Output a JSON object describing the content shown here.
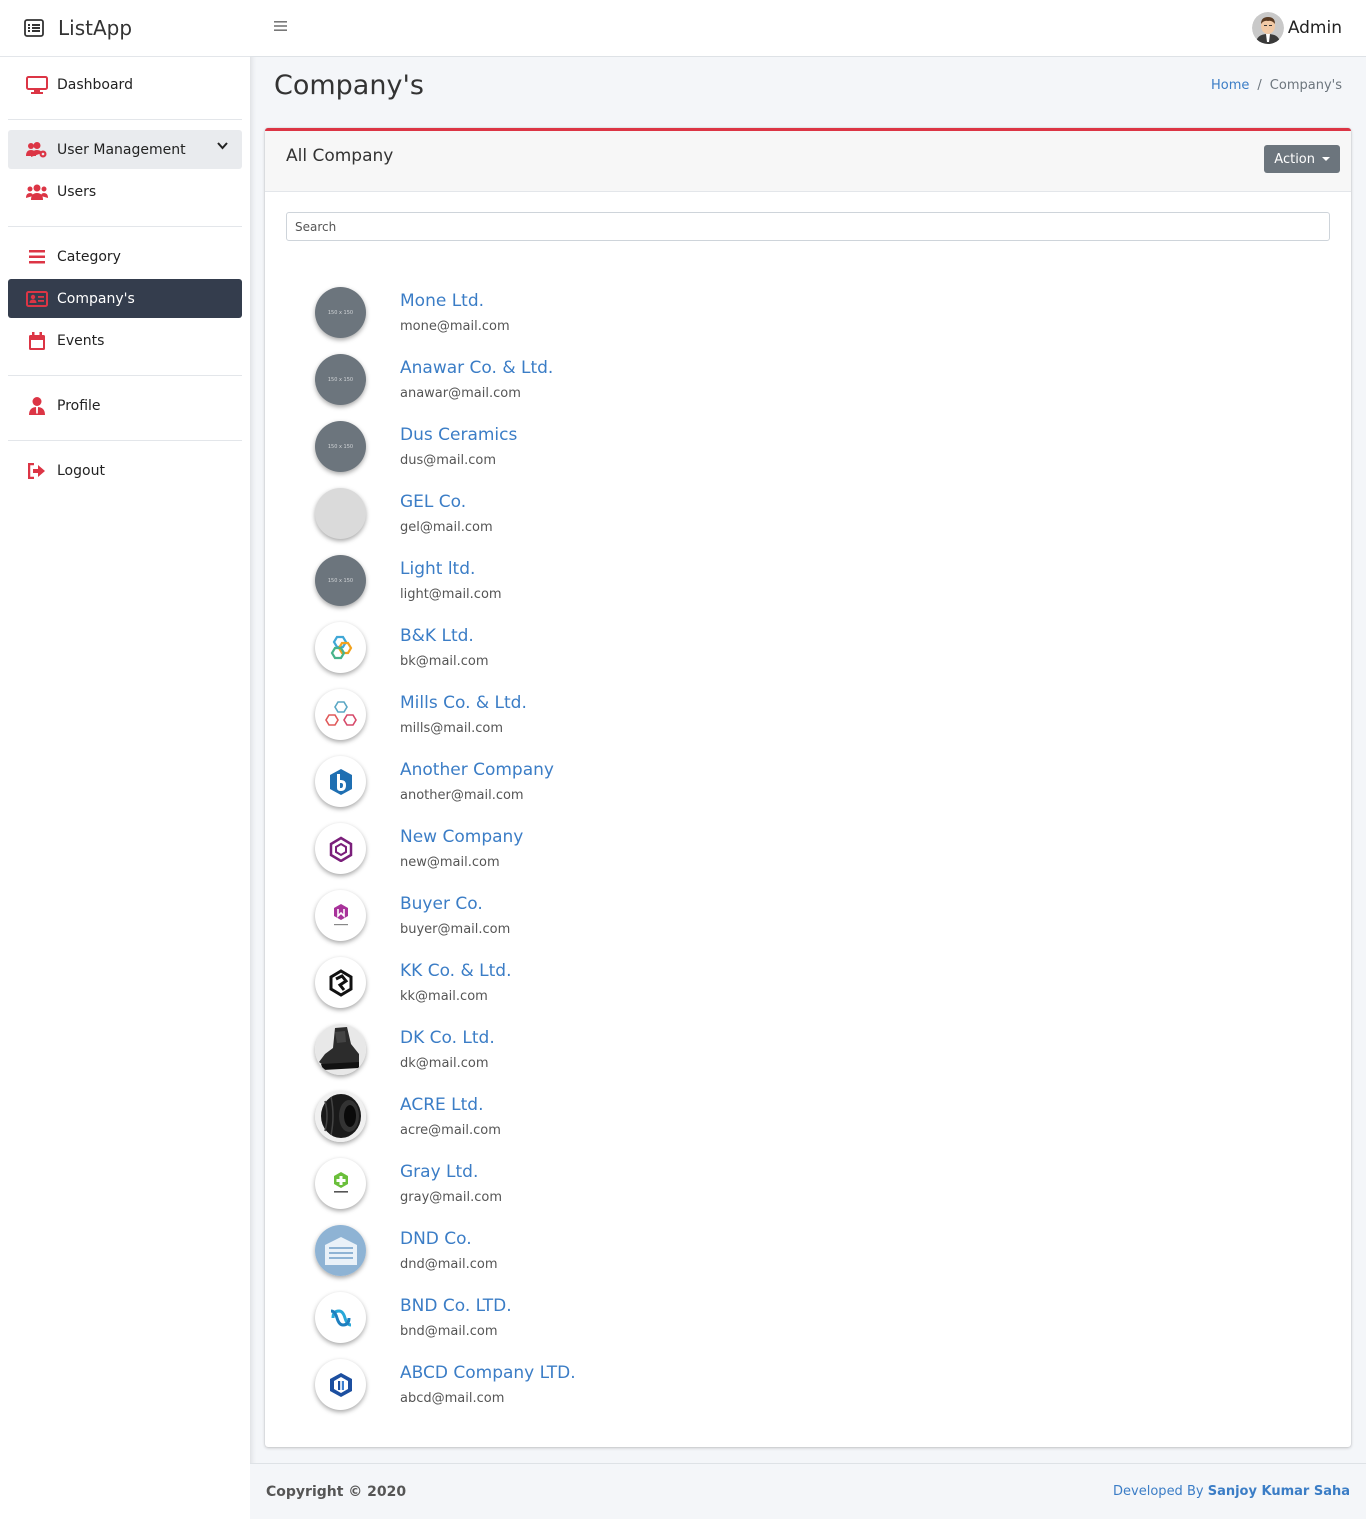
{
  "app": {
    "name": "ListApp"
  },
  "sidebar": {
    "items": [
      {
        "label": "Dashboard",
        "icon": "monitor-icon"
      },
      {
        "label": "User Management",
        "icon": "users-cog-icon"
      },
      {
        "label": "Users",
        "icon": "users-icon"
      },
      {
        "label": "Category",
        "icon": "list-icon"
      },
      {
        "label": "Company's",
        "icon": "id-card-icon"
      },
      {
        "label": "Events",
        "icon": "calendar-icon"
      },
      {
        "label": "Profile",
        "icon": "user-tie-icon"
      },
      {
        "label": "Logout",
        "icon": "sign-out-icon"
      }
    ]
  },
  "topbar": {
    "user_name": "Admin"
  },
  "header": {
    "title": "Company's",
    "breadcrumb": {
      "home": "Home",
      "current": "Company's"
    }
  },
  "card": {
    "title": "All Company",
    "action_label": "Action",
    "search_placeholder": "Search"
  },
  "companies": [
    {
      "name": "Mone Ltd.",
      "email": "mone@mail.com",
      "logo": "placeholder",
      "ph": "150 x 150"
    },
    {
      "name": "Anawar Co. & Ltd.",
      "email": "anawar@mail.com",
      "logo": "placeholder",
      "ph": "150 x 150"
    },
    {
      "name": "Dus Ceramics",
      "email": "dus@mail.com",
      "logo": "placeholder",
      "ph": "150 x 150"
    },
    {
      "name": "GEL Co.",
      "email": "gel@mail.com",
      "logo": "placeholder-light",
      "ph": ""
    },
    {
      "name": "Light ltd.",
      "email": "light@mail.com",
      "logo": "placeholder",
      "ph": "150 x 150"
    },
    {
      "name": "B&K Ltd.",
      "email": "bk@mail.com",
      "logo": "hex-links",
      "ph": ""
    },
    {
      "name": "Mills Co. & Ltd.",
      "email": "mills@mail.com",
      "logo": "three-hex",
      "ph": ""
    },
    {
      "name": "Another Company",
      "email": "another@mail.com",
      "logo": "blue-b",
      "ph": ""
    },
    {
      "name": "New Company",
      "email": "new@mail.com",
      "logo": "purple-cube",
      "ph": ""
    },
    {
      "name": "Buyer Co.",
      "email": "buyer@mail.com",
      "logo": "purple-hex",
      "ph": ""
    },
    {
      "name": "KK Co. & Ltd.",
      "email": "kk@mail.com",
      "logo": "black-knot",
      "ph": ""
    },
    {
      "name": "DK Co. Ltd.",
      "email": "dk@mail.com",
      "logo": "boot-photo",
      "ph": ""
    },
    {
      "name": "ACRE Ltd.",
      "email": "acre@mail.com",
      "logo": "pipe-photo",
      "ph": ""
    },
    {
      "name": "Gray Ltd.",
      "email": "gray@mail.com",
      "logo": "green-cross",
      "ph": ""
    },
    {
      "name": "DND Co.",
      "email": "dnd@mail.com",
      "logo": "building",
      "ph": ""
    },
    {
      "name": "BND Co. LTD.",
      "email": "bnd@mail.com",
      "logo": "blue-loop",
      "ph": ""
    },
    {
      "name": "ABCD Company LTD.",
      "email": "abcd@mail.com",
      "logo": "blue-cube",
      "ph": ""
    }
  ],
  "footer": {
    "copyright": "Copyright © 2020",
    "dev_prefix": "Developed By",
    "dev_name": "Sanjoy Kumar Saha"
  },
  "colors": {
    "accent": "#dc3545",
    "link": "#3b7dc6",
    "sidebar_active": "#343d4d"
  }
}
